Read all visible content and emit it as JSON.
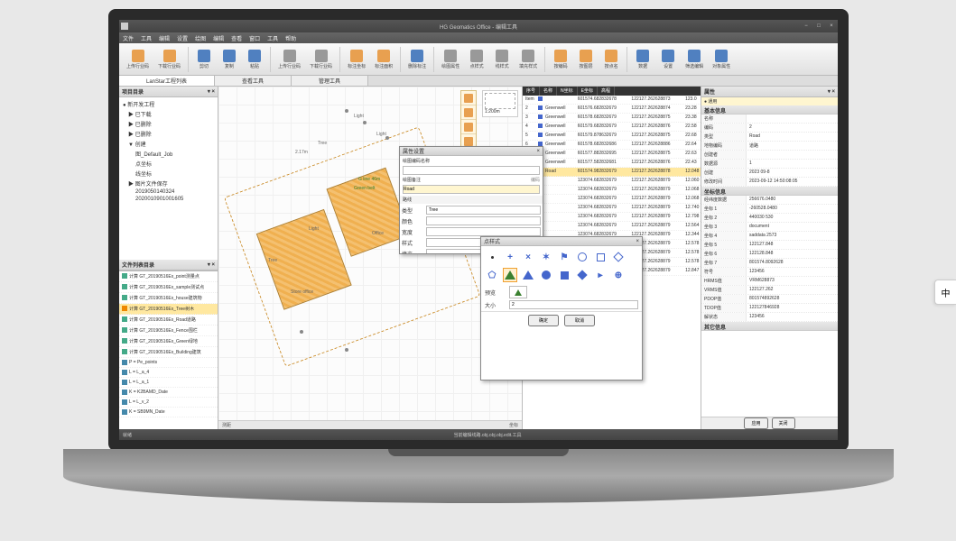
{
  "lang_tab": "中",
  "titlebar": {
    "title": "HG Geomatics Office - 编辑工具"
  },
  "menubar": {
    "items": [
      "文件",
      "工具",
      "编辑",
      "设置",
      "绘图",
      "编辑",
      "查看",
      "窗口",
      "工具",
      "帮助"
    ]
  },
  "ribbon": {
    "groups": [
      [
        "上传行业码",
        "下载行业码"
      ],
      [
        "剪切",
        "复制",
        "粘贴"
      ],
      [
        "上传行业码",
        "下载行业码"
      ],
      [
        "标注坐标",
        "标注面积"
      ],
      [
        "删除标注"
      ],
      [
        "绘图属性",
        "点样式",
        "线样式",
        "填充样式"
      ],
      [
        "按编码",
        "按图层",
        "按点名"
      ],
      [
        "数据",
        "设置",
        "筛选编辑",
        "对象属性"
      ]
    ]
  },
  "tabs": {
    "items": [
      "LanStar工程列表",
      "查看工具",
      "管理工具"
    ],
    "active": 0
  },
  "tree": {
    "header": "项目目录",
    "items": [
      {
        "label": "● 新开发工程",
        "lvl": 0,
        "exp": true
      },
      {
        "label": "▶ 已下载",
        "lvl": 1
      },
      {
        "label": "▶ 已删除",
        "lvl": 1
      },
      {
        "label": "▶ 已删除",
        "lvl": 1
      },
      {
        "label": "▼ 创建",
        "lvl": 1,
        "exp": true
      },
      {
        "label": "图_Default_Job",
        "lvl": 2
      },
      {
        "label": "点坐标",
        "lvl": 2
      },
      {
        "label": "线坐标",
        "lvl": 2
      },
      {
        "label": "▶ 图片文件保存",
        "lvl": 1
      },
      {
        "label": "2019050140324",
        "lvl": 2
      },
      {
        "label": "2020010901001605",
        "lvl": 2
      }
    ]
  },
  "files": {
    "header": "文件列表目录",
    "items": [
      {
        "icon": "green",
        "name": "计算 GT_20190516Ex_point测量点"
      },
      {
        "icon": "green",
        "name": "计算 GT_20190516Ex_sample测试点"
      },
      {
        "icon": "green",
        "name": "计算 GT_20190516Ex_house建筑物"
      },
      {
        "icon": "orange",
        "name": "计算 GT_20190516Ex_Tree树木",
        "selected": true
      },
      {
        "icon": "green",
        "name": "计算 GT_20190516Ex_Road道路"
      },
      {
        "icon": "green",
        "name": "计算 GT_20190516Ex_Fence围栏"
      },
      {
        "icon": "green",
        "name": "计算 GT_20190516Ex_Green绿地"
      },
      {
        "icon": "green",
        "name": "计算 GT_20190516Ex_Building建筑"
      },
      {
        "icon": "blue",
        "name": "P = Pe_points"
      },
      {
        "icon": "blue",
        "name": "L = L_a_4"
      },
      {
        "icon": "blue",
        "name": "L = L_a_1"
      },
      {
        "icon": "blue",
        "name": "K = K2BAMD_Date"
      },
      {
        "icon": "blue",
        "name": "L = L_v_2"
      },
      {
        "icon": "blue",
        "name": "K = SB9MN_Date"
      }
    ]
  },
  "canvas": {
    "scale": "1:200m",
    "labels": [
      "Light",
      "Light",
      "Light",
      "Tree",
      "Tree",
      "2.17m",
      "32.5m",
      "Green belt",
      "Store office",
      "Office",
      "G line 46m"
    ],
    "coord_left": "测距",
    "coord_right": "坐标"
  },
  "vtoolbar": {
    "items": [
      "选择",
      "平移",
      "放大",
      "缩小",
      "测距",
      "标注",
      "删除"
    ]
  },
  "data_panel": {
    "tabs": [
      "序号",
      "名称",
      "N坐标",
      "E坐标",
      "高程"
    ],
    "rows": [
      {
        "idx": "Item 1",
        "name": "",
        "n": "601574.682832678",
        "e": "122127.262628873",
        "h": "123.0"
      },
      {
        "idx": "2",
        "name": "Greenwell",
        "n": "601576.682832679",
        "e": "122127.262628874",
        "h": "23.28"
      },
      {
        "idx": "3",
        "name": "Greenwell",
        "n": "601578.682832679",
        "e": "122127.262628875",
        "h": "23.38"
      },
      {
        "idx": "4",
        "name": "Greenwell",
        "n": "601579.682832679",
        "e": "122127.262628876",
        "h": "22.58"
      },
      {
        "idx": "5",
        "name": "Greenwell",
        "n": "601579.878632679",
        "e": "122127.262628875",
        "h": "22.68"
      },
      {
        "idx": "6",
        "name": "Greenwell",
        "n": "601578.682832686",
        "e": "122127.262628886",
        "h": "22.64"
      },
      {
        "idx": "7",
        "name": "Greenwell",
        "n": "601577.882832695",
        "e": "122127.262628875",
        "h": "22.63"
      },
      {
        "idx": "8",
        "name": "Greenwell",
        "n": "601577.582832681",
        "e": "122127.262628876",
        "h": "22.43"
      },
      {
        "idx": "9",
        "name": "Road",
        "n": "601574.982832679",
        "e": "122127.262628878",
        "h": "12.048",
        "selected": true
      },
      {
        "idx": "10",
        "name": "",
        "n": "123074.682832679",
        "e": "122127.262628879",
        "h": "12.060"
      },
      {
        "idx": "11",
        "name": "",
        "n": "123074.682832679",
        "e": "122127.262628879",
        "h": "12.068"
      },
      {
        "idx": "12",
        "name": "",
        "n": "123074.682832679",
        "e": "122127.262628879",
        "h": "12.068"
      },
      {
        "idx": "13",
        "name": "",
        "n": "123074.682832679",
        "e": "122127.262628879",
        "h": "12.740"
      },
      {
        "idx": "14",
        "name": "",
        "n": "123074.682832679",
        "e": "122127.262628879",
        "h": "12.798"
      },
      {
        "idx": "15",
        "name": "",
        "n": "123074.682832679",
        "e": "122127.262628879",
        "h": "12.564"
      },
      {
        "idx": "16",
        "name": "",
        "n": "123074.682832679",
        "e": "122127.262628879",
        "h": "12.344"
      },
      {
        "idx": "17",
        "name": "",
        "n": "123074.682832679",
        "e": "122127.262628879",
        "h": "12.578"
      },
      {
        "idx": "18",
        "name": "",
        "n": "123074.682832679",
        "e": "122127.262628879",
        "h": "12.578"
      },
      {
        "idx": "19",
        "name": "",
        "n": "123074.682832679",
        "e": "122127.262628879",
        "h": "12.578"
      },
      {
        "idx": "20",
        "name": "",
        "n": "123074.682832679",
        "e": "122127.262628879",
        "h": "12.847"
      }
    ]
  },
  "props": {
    "header": "属性",
    "sub_header": "● 通用",
    "group1": "基本信息",
    "rows1": [
      {
        "k": "名称",
        "v": ""
      },
      {
        "k": "编码",
        "v": "2"
      },
      {
        "k": "类型",
        "v": "Road"
      },
      {
        "k": "地物编码",
        "v": "道路"
      },
      {
        "k": "创建者",
        "v": ""
      },
      {
        "k": "数据源",
        "v": "1"
      },
      {
        "k": "创建",
        "v": "2023 09-8"
      },
      {
        "k": "修改时间",
        "v": "2023-09-12 14:50:08:05"
      }
    ],
    "group2": "坐标信息",
    "rows2": [
      {
        "k": "经纬度数据",
        "v": "256676.0480"
      },
      {
        "k": "坐标 1",
        "v": "-260528.0480"
      },
      {
        "k": "坐标 2",
        "v": "440030 530"
      },
      {
        "k": "坐标 3",
        "v": "document"
      },
      {
        "k": "坐标 4",
        "v": "saddata 2573"
      },
      {
        "k": "坐标 5",
        "v": "122127.848"
      },
      {
        "k": "坐标 6",
        "v": "122128.848"
      },
      {
        "k": "坐标 7",
        "v": "801574.8092628"
      },
      {
        "k": "符号",
        "v": "123456"
      },
      {
        "k": "HRMS值",
        "v": "VRM628873"
      },
      {
        "k": "VRMS值",
        "v": "122127.262"
      },
      {
        "k": "PDOP值",
        "v": "801574892628"
      },
      {
        "k": "TDOP值",
        "v": "122127846928"
      },
      {
        "k": "解状态",
        "v": "123456"
      }
    ],
    "group3": "其它信息",
    "btn_apply": "应用",
    "btn_close": "关闭"
  },
  "dlg_attr": {
    "title": "属性设置",
    "name_label": "绘图编码名称",
    "code_label": "绘图备注",
    "name_value": "",
    "code_value": "Road",
    "sub_title": "路线",
    "sub_rows": [
      {
        "k": "类型",
        "v": "Tree"
      },
      {
        "k": "颜色",
        "v": ""
      },
      {
        "k": "宽度",
        "v": ""
      },
      {
        "k": "样式",
        "v": ""
      },
      {
        "k": "填充",
        "v": ""
      }
    ],
    "btn_ok": "确定",
    "btn_cancel": "取消"
  },
  "dlg_symbol": {
    "title": "点样式",
    "preview_label": "预览",
    "size_label": "大小",
    "size_value": "2",
    "btn_ok": "确定",
    "btn_cancel": "取消"
  },
  "statusbar": {
    "left": "就绪",
    "center": "当前编辑线路.obj.obj.obj.edit.工具"
  }
}
